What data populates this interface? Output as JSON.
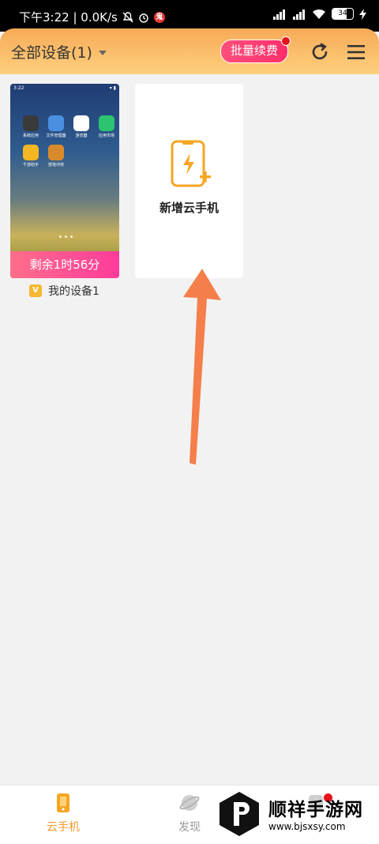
{
  "status_bar": {
    "time_speed": "下午3:22 | 0.0K/s",
    "badge": "鬼",
    "battery": "34"
  },
  "header": {
    "device_selector": "全部设备(1)",
    "renew_button": "批量续费"
  },
  "device_card": {
    "screen_time": "3:22",
    "apps": [
      {
        "label": "系统应用",
        "color": "#3a3a3a"
      },
      {
        "label": "文件管理器",
        "color": "#4a90e2"
      },
      {
        "label": "游览器",
        "color": "#ffffff"
      },
      {
        "label": "应用市场",
        "color": "#2bc36f"
      },
      {
        "label": "千游助手",
        "color": "#f5b623"
      },
      {
        "label": "部落冲突",
        "color": "#d98b2b"
      }
    ],
    "time_left": "剩余1时56分",
    "vip_badge": "V",
    "name": "我的设备1"
  },
  "add_card": {
    "label": "新增云手机"
  },
  "bottom_nav": {
    "cloud_phone": "云手机",
    "discover": "发现"
  },
  "watermark": {
    "title": "顺祥手游网",
    "url": "www.bjsxsy.com"
  },
  "colors": {
    "accent": "#f59a2d",
    "header_gradient": [
      "#f7aa58",
      "#ffd07d"
    ],
    "renew_button": "#ff3b6c",
    "time_left_bar": "#ff4f98",
    "arrow": "#f47f4a"
  }
}
